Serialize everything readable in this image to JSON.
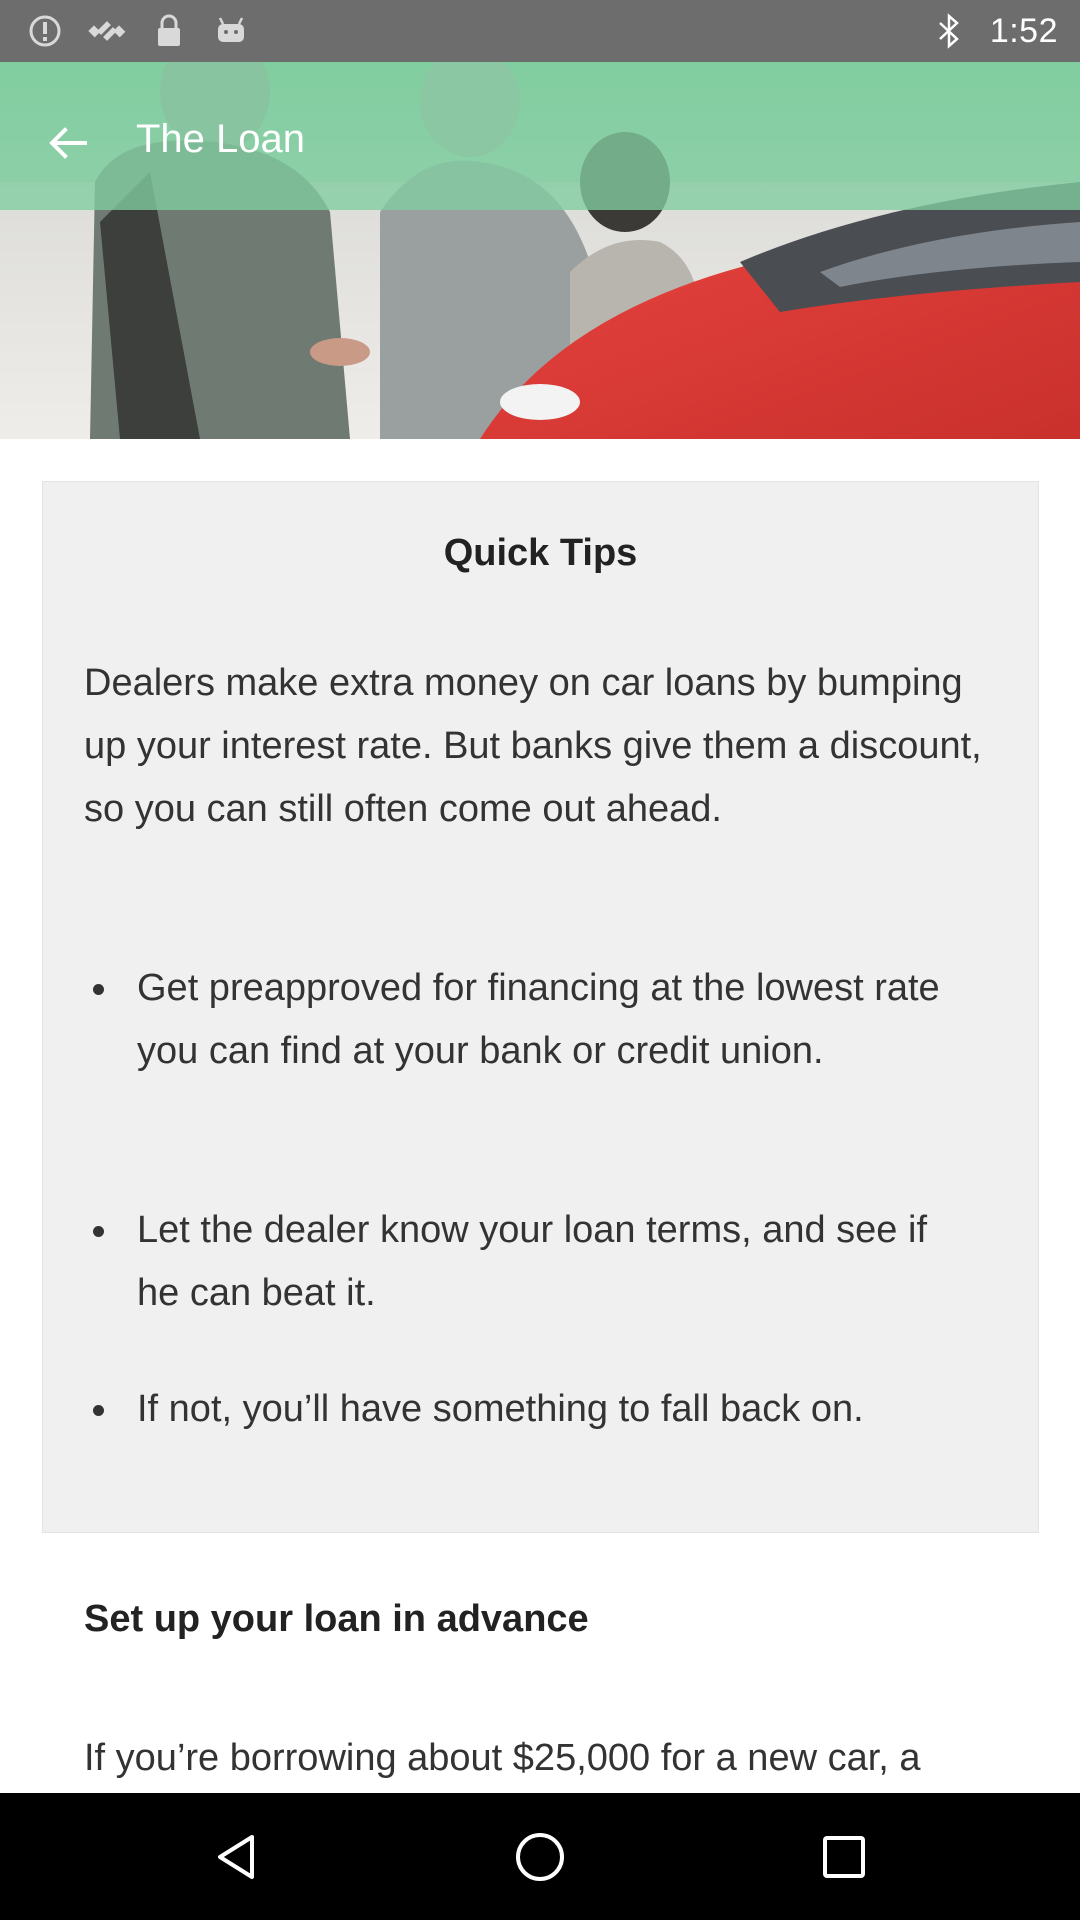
{
  "status_bar": {
    "time": "1:52",
    "left_icons": [
      "info-circle-icon",
      "no-satellite-icon",
      "lock-icon",
      "android-icon"
    ],
    "right_icons": [
      "bluetooth-icon"
    ]
  },
  "header": {
    "title": "The Loan",
    "back_icon": "arrow-left-icon",
    "toolbar_color": "#82cda0"
  },
  "card": {
    "title": "Quick Tips",
    "intro": "Dealers make extra money on car loans by bumping up your interest rate. But banks give them a discount, so you can still often come out ahead.",
    "tips": [
      "Get preapproved for financing at the lowest rate you can find at your bank or credit union.",
      "Let the dealer know your loan terms, and see if he can beat it.",
      "If not, you’ll have something to fall back on."
    ]
  },
  "section": {
    "heading": "Set up your loan in advance",
    "body": "If you’re borrowing about $25,000 for a new car, a"
  },
  "nav_bar": {
    "icons": [
      "back-triangle-icon",
      "home-circle-icon",
      "recents-square-icon"
    ]
  }
}
